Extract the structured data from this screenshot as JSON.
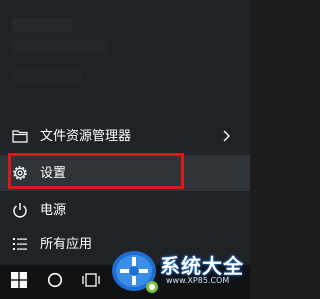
{
  "start_menu": {
    "items": [
      {
        "label": "文件资源管理器",
        "icon": "folder-icon"
      },
      {
        "label": "设置",
        "icon": "gear-icon"
      },
      {
        "label": "电源",
        "icon": "power-icon"
      },
      {
        "label": "所有应用",
        "icon": "list-icon"
      }
    ]
  },
  "taskbar": {
    "buttons": [
      "windows-start-icon",
      "cortana-circle-icon",
      "task-view-icon"
    ]
  },
  "watermark": {
    "text": "系统大全",
    "url": "www.XP85.COM"
  },
  "colors": {
    "highlight": "#e0141b",
    "menu_bg": "#1f2326",
    "selected_bg": "#2f3438",
    "taskbar_bg": "#101214",
    "watermark_blue": "#1e6fd1"
  }
}
